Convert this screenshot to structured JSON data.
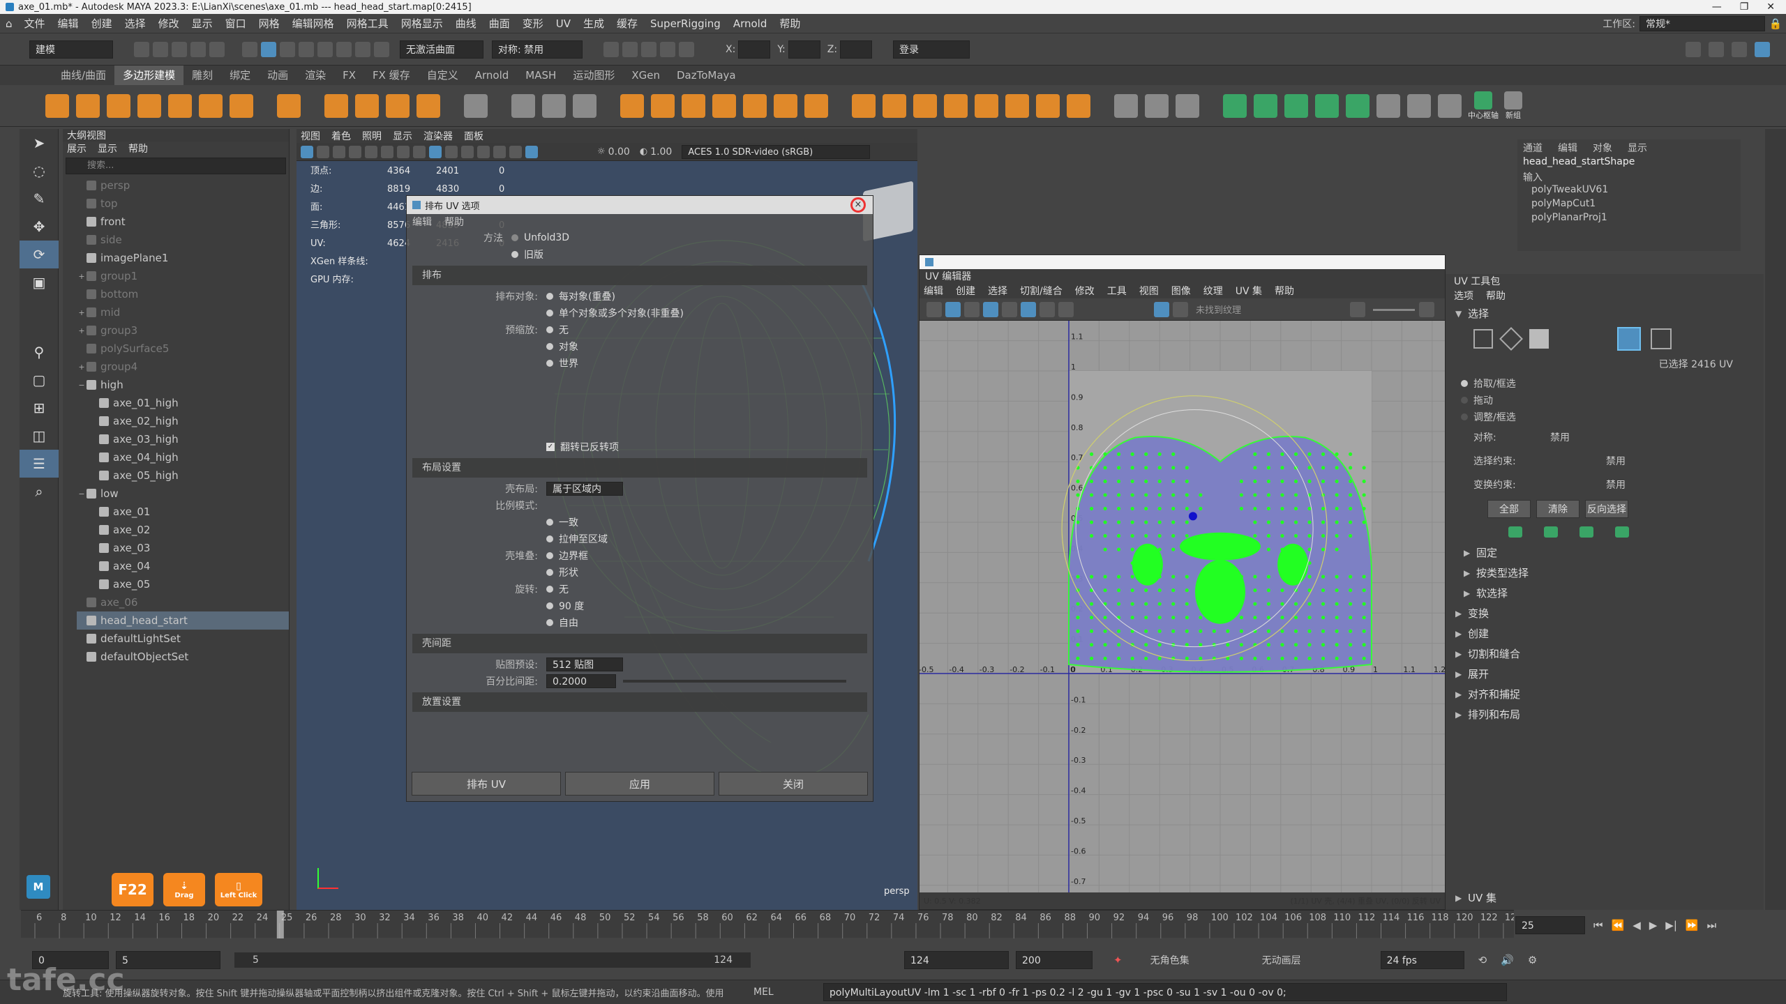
{
  "window": {
    "title": "axe_01.mb* - Autodesk MAYA 2023.3: E:\\LianXi\\scenes\\axe_01.mb   ---   head_head_start.map[0:2415]",
    "controls": [
      "—",
      "❐",
      "✕"
    ]
  },
  "menubar": {
    "items": [
      "文件",
      "编辑",
      "创建",
      "选择",
      "修改",
      "显示",
      "窗口",
      "网格",
      "编辑网格",
      "网格工具",
      "网格显示",
      "曲线",
      "曲面",
      "变形",
      "UV",
      "生成",
      "缓存",
      "SuperRigging",
      "Arnold",
      "帮助"
    ],
    "workspace_label": "工作区:",
    "workspace_value": "常规*"
  },
  "statusline": {
    "mode": "建模",
    "no_live": "无激活曲面",
    "symmetry": "对称: 禁用",
    "x_label": "X:",
    "y_label": "Y:",
    "z_label": "Z:",
    "login": "登录"
  },
  "shelf": {
    "tabs": [
      "曲线/曲面",
      "多边形建模",
      "雕刻",
      "绑定",
      "动画",
      "渲染",
      "FX",
      "FX 缓存",
      "自定义",
      "Arnold",
      "MASH",
      "运动图形",
      "XGen",
      "DazToMaya"
    ],
    "active": "多边形建模",
    "right_labels": [
      "中心枢轴",
      "新组"
    ]
  },
  "outliner": {
    "title": "大纲视图",
    "menu": [
      "展示",
      "显示",
      "帮助"
    ],
    "search_placeholder": "搜索...",
    "items": [
      {
        "label": "persp",
        "dim": true,
        "exp": ""
      },
      {
        "label": "top",
        "dim": true,
        "exp": ""
      },
      {
        "label": "front",
        "dim": false,
        "exp": ""
      },
      {
        "label": "side",
        "dim": true,
        "exp": ""
      },
      {
        "label": "imagePlane1",
        "dim": false,
        "exp": ""
      },
      {
        "label": "group1",
        "dim": true,
        "exp": "+"
      },
      {
        "label": "bottom",
        "dim": true,
        "exp": ""
      },
      {
        "label": "mid",
        "dim": true,
        "exp": "+"
      },
      {
        "label": "group3",
        "dim": true,
        "exp": "+"
      },
      {
        "label": "polySurface5",
        "dim": true,
        "exp": ""
      },
      {
        "label": "group4",
        "dim": true,
        "exp": "+"
      },
      {
        "label": "high",
        "dim": false,
        "exp": "−"
      },
      {
        "label": "axe_01_high",
        "dim": false,
        "exp": "",
        "indent": true
      },
      {
        "label": "axe_02_high",
        "dim": false,
        "exp": "",
        "indent": true
      },
      {
        "label": "axe_03_high",
        "dim": false,
        "exp": "",
        "indent": true
      },
      {
        "label": "axe_04_high",
        "dim": false,
        "exp": "",
        "indent": true
      },
      {
        "label": "axe_05_high",
        "dim": false,
        "exp": "",
        "indent": true
      },
      {
        "label": "low",
        "dim": false,
        "exp": "−"
      },
      {
        "label": "axe_01",
        "dim": false,
        "exp": "",
        "indent": true
      },
      {
        "label": "axe_02",
        "dim": false,
        "exp": "",
        "indent": true
      },
      {
        "label": "axe_03",
        "dim": false,
        "exp": "",
        "indent": true
      },
      {
        "label": "axe_04",
        "dim": false,
        "exp": "",
        "indent": true
      },
      {
        "label": "axe_05",
        "dim": false,
        "exp": "",
        "indent": true
      },
      {
        "label": "axe_06",
        "dim": true,
        "exp": ""
      },
      {
        "label": "head_head_start",
        "dim": false,
        "exp": "",
        "sel": true
      },
      {
        "label": "defaultLightSet",
        "dim": false,
        "exp": ""
      },
      {
        "label": "defaultObjectSet",
        "dim": false,
        "exp": ""
      }
    ]
  },
  "viewport": {
    "menu": [
      "视图",
      "着色",
      "照明",
      "显示",
      "渲染器",
      "面板"
    ],
    "exposure": "0.00",
    "gamma": "1.00",
    "colorspace": "ACES 1.0 SDR-video (sRGB)",
    "camera": "persp",
    "hud": [
      {
        "label": "顶点:",
        "a": "4364",
        "b": "2401",
        "c": "0"
      },
      {
        "label": "边:",
        "a": "8819",
        "b": "4830",
        "c": "0"
      },
      {
        "label": "面:",
        "a": "4461",
        "b": "2415",
        "c": "0"
      },
      {
        "label": "三角形:",
        "a": "8576",
        "b": "4830",
        "c": "0"
      },
      {
        "label": "UV:",
        "a": "4624",
        "b": "2416",
        "c": "0"
      },
      {
        "label": "XGen 样条线:",
        "a": "",
        "b": "",
        "c": ""
      },
      {
        "label": "GPU 内存:",
        "a": "",
        "b": "",
        "c": ""
      }
    ]
  },
  "layout_window": {
    "title": "排布 UV 选项",
    "menu": [
      "编辑",
      "帮助"
    ],
    "method_label": "方法",
    "method_unfold": "Unfold3D",
    "method_legacy": "旧版",
    "sec_layout": "排布",
    "layout_objects_label": "排布对象:",
    "layout_objects": [
      "每对象(重叠)",
      "单个对象或多个对象(非重叠)"
    ],
    "prescale_label": "预缩放:",
    "prescale": [
      "无",
      "对象",
      "世界"
    ],
    "shell_flip": "翻转已反转项",
    "sec_settings": "布局设置",
    "shell_fill_label": "壳布局:",
    "shell_fill": "属于区域内",
    "scale_label": "比例模式:",
    "scale": [
      "一致",
      "拉伸至区域"
    ],
    "pack_label": "壳堆叠:",
    "pack": [
      "边界框",
      "形状"
    ],
    "rotate_label": "旋转:",
    "rotate": [
      "无",
      "90 度",
      "自由"
    ],
    "sec_spacing": "壳间距",
    "tex_preset_label": "贴图预设:",
    "tex_preset": "512 贴图",
    "pct_label": "百分比间距:",
    "pct": "0.2000",
    "sec_place": "放置设置",
    "btn_layout": "排布 UV",
    "btn_apply": "应用",
    "btn_close": "关闭"
  },
  "uv_editor": {
    "title": "UV 编辑器",
    "menu": [
      "编辑",
      "创建",
      "选择",
      "切割/缝合",
      "修改",
      "工具",
      "视图",
      "图像",
      "纹理",
      "UV 集",
      "帮助"
    ],
    "tex_label": "未找到纹理",
    "status_left": "U: 0.5 V: 0.382",
    "status_right": "(1/1) UV 壳, (4/4) 重叠 UV, (0/0) 反转 UV",
    "x_ticks": [
      "-0.5",
      "-0.4",
      "-0.3",
      "-0.2",
      "-0.1",
      "0",
      "0.1",
      "0.2",
      "0.3",
      "0.4",
      "0.5",
      "0.6",
      "0.7",
      "0.8",
      "0.9",
      "1",
      "1.1",
      "1.2"
    ],
    "y_ticks": [
      "1.1",
      "1",
      "0.9",
      "0.8",
      "0.7",
      "0.6",
      "0.5",
      "0.4",
      "0.3",
      "0.2",
      "0.1",
      "0",
      "-0.1",
      "-0.2",
      "-0.3",
      "-0.4",
      "-0.5",
      "-0.6",
      "-0.7"
    ]
  },
  "uv_toolkit": {
    "title": "UV 工具包",
    "menu": [
      "选项",
      "帮助"
    ],
    "sec_select": "选择",
    "selected_count": "已选择 2416 UV",
    "opt_pick": "拾取/框选",
    "opt_drag": "拖动",
    "opt_tweak": "调整/框选",
    "symmetry_label": "对称:",
    "symmetry": "禁用",
    "sel_constraint_label": "选择约束:",
    "sel_constraint": "禁用",
    "xform_constraint_label": "变换约束:",
    "xform_constraint": "禁用",
    "btn_all": "全部",
    "btn_clear": "清除",
    "btn_invert": "反向选择",
    "sections": [
      "固定",
      "按类型选择",
      "软选择",
      "变换",
      "创建",
      "切割和缝合",
      "展开",
      "对齐和捕捉",
      "排列和布局"
    ],
    "uv_sets": "UV 集"
  },
  "channel_box": {
    "menu": [
      "通道",
      "编辑",
      "对象",
      "显示"
    ],
    "shape": "head_head_startShape",
    "inputs": "输入",
    "nodes": [
      "polyTweakUV61",
      "polyMapCut1",
      "polyPlanarProj1"
    ]
  },
  "timeline": {
    "ticks": [
      "6",
      "8",
      "10",
      "12",
      "14",
      "16",
      "18",
      "20",
      "22",
      "24",
      "25",
      "26",
      "28",
      "30",
      "32",
      "34",
      "36",
      "38",
      "40",
      "42",
      "44",
      "46",
      "48",
      "50",
      "52",
      "54",
      "56",
      "58",
      "60",
      "62",
      "64",
      "66",
      "68",
      "70",
      "72",
      "74",
      "76",
      "78",
      "80",
      "82",
      "84",
      "86",
      "88",
      "90",
      "92",
      "94",
      "96",
      "98",
      "100",
      "102",
      "104",
      "106",
      "108",
      "110",
      "112",
      "114",
      "116",
      "118",
      "120",
      "122",
      "124"
    ],
    "current": "25",
    "frame_field": "25"
  },
  "range": {
    "start": "0",
    "min": "5",
    "slider_start": "5",
    "slider_end": "124",
    "end": "124",
    "max": "200",
    "charset": "无角色集",
    "anim_layer": "无动画层",
    "fps": "24 fps"
  },
  "cmdline": {
    "help": "旋转工具: 使用操纵器旋转对象。按住 Shift 键并拖动操纵器轴或平面控制柄以挤出组件或克隆对象。按住 Ctrl + Shift + 鼠标左键并拖动，以约束沿曲面移动。使用 D 或 Ins",
    "lang": "MEL",
    "command": "polyMultiLayoutUV -lm 1 -sc 1 -rbf 0 -fr 1 -ps 0.2 -l 2 -gu 1 -gv 1 -psc 0 -su 1 -sv 1 -ou 0 -ov 0;"
  },
  "keys": {
    "k1": "F22",
    "k2": "Drag",
    "k3": "Left Click"
  },
  "watermark": "tafe.cc"
}
